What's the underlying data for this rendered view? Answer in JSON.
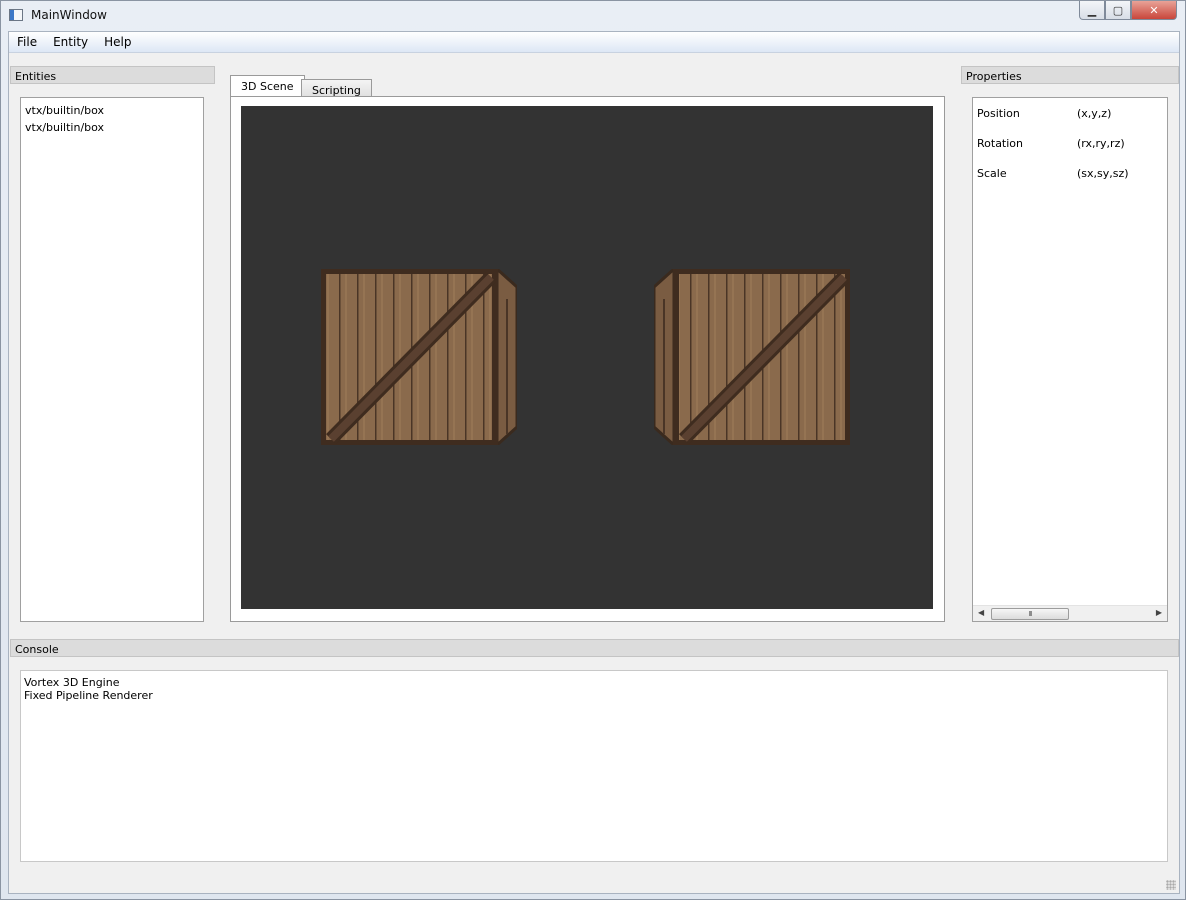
{
  "window": {
    "title": "MainWindow",
    "controls": {
      "minimize": "▁",
      "maximize": "▢",
      "close": "✕"
    }
  },
  "menu": {
    "items": [
      {
        "label": "File"
      },
      {
        "label": "Entity"
      },
      {
        "label": "Help"
      }
    ]
  },
  "entities_panel": {
    "title": "Entities",
    "items": [
      {
        "label": "vtx/builtin/box"
      },
      {
        "label": "vtx/builtin/box"
      }
    ]
  },
  "tabs": [
    {
      "label": "3D Scene",
      "active": true
    },
    {
      "label": "Scripting",
      "active": false
    }
  ],
  "scene": {
    "background_color": "#333333",
    "crate_color": "#8a6a4c",
    "objects": [
      {
        "name": "box",
        "facing": "right-side-visible"
      },
      {
        "name": "box",
        "facing": "left-side-visible"
      }
    ]
  },
  "properties_panel": {
    "title": "Properties",
    "rows": [
      {
        "name": "Position",
        "value": "(x,y,z)"
      },
      {
        "name": "Rotation",
        "value": "(rx,ry,rz)"
      },
      {
        "name": "Scale",
        "value": "(sx,sy,sz)"
      }
    ],
    "scrollbar": {
      "left_arrow": "◀",
      "right_arrow": "▶",
      "grip": "III"
    }
  },
  "console_panel": {
    "title": "Console",
    "lines": [
      {
        "text": "Vortex 3D Engine"
      },
      {
        "text": "Fixed Pipeline Renderer"
      }
    ]
  }
}
